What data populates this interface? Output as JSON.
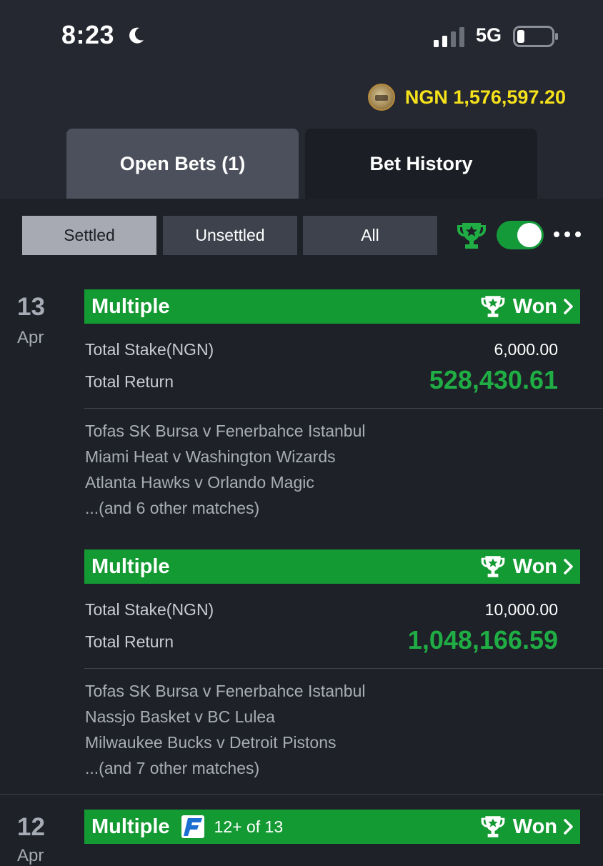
{
  "status_bar": {
    "time": "8:23",
    "network": "5G"
  },
  "account": {
    "balance": "NGN 1,576,597.20"
  },
  "tabs": [
    {
      "label": "Open Bets (1)"
    },
    {
      "label": "Bet History"
    }
  ],
  "filters": [
    {
      "label": "Settled"
    },
    {
      "label": "Unsettled"
    },
    {
      "label": "All"
    }
  ],
  "toggle": {
    "state": "on"
  },
  "colors": {
    "won_green": "#149a33",
    "balance_yellow": "#f5e21b",
    "return_green": "#1fad44"
  },
  "groups": [
    {
      "day": "13",
      "month": "Apr",
      "bets": [
        {
          "type": "Multiple",
          "result": "Won",
          "stake_label": "Total Stake(NGN)",
          "stake": "6,000.00",
          "return_label": "Total Return",
          "return": "528,430.61",
          "matches": [
            "Tofas SK Bursa v Fenerbahce Istanbul",
            "Miami Heat v Washington Wizards",
            "Atlanta Hawks v Orlando Magic",
            "...(and 6 other matches)"
          ]
        },
        {
          "type": "Multiple",
          "result": "Won",
          "stake_label": "Total Stake(NGN)",
          "stake": "10,000.00",
          "return_label": "Total Return",
          "return": "1,048,166.59",
          "matches": [
            "Tofas SK Bursa v Fenerbahce Istanbul",
            "Nassjo Basket v BC Lulea",
            "Milwaukee Bucks v Detroit Pistons",
            "...(and 7 other matches)"
          ]
        }
      ]
    },
    {
      "day": "12",
      "month": "Apr",
      "bets": [
        {
          "type": "Multiple",
          "promo": "12+ of 13",
          "promo_icon": "f-badge-icon",
          "result": "Won"
        }
      ]
    }
  ]
}
